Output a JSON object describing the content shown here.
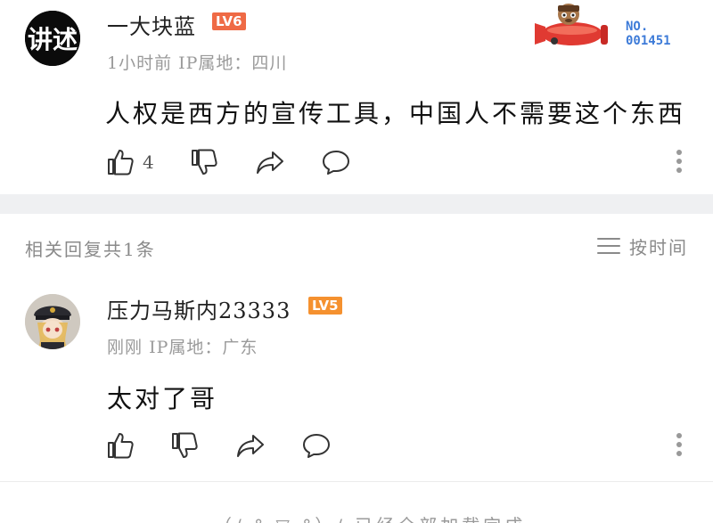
{
  "main_comment": {
    "avatar_text": "讲述",
    "username": "一大块蓝",
    "level": "LV6",
    "time": "1小时前",
    "ip": "IP属地：四川",
    "content": "人权是西方的宣传工具，中国人不需要这个东西",
    "like_count": "4",
    "badge": {
      "label": "NO.",
      "number": "001451"
    }
  },
  "replies_header": {
    "count_text": "相关回复共1条",
    "sort_label": "按时间"
  },
  "reply_comment": {
    "username": "压力马斯内23333",
    "level": "LV5",
    "time": "刚刚",
    "ip": "IP属地：广东",
    "content": "太对了哥"
  },
  "footer": {
    "note": "（/ ° ▽ °）/ 已经全部加载完成"
  },
  "colors": {
    "lv6": "#ef6a45",
    "lv5": "#f5912f",
    "divider": "#eff0f2",
    "badge_blue": "#3d7bd8"
  },
  "icons": [
    "like-icon",
    "dislike-icon",
    "share-icon",
    "comment-icon",
    "more-icon",
    "sort-icon",
    "plane-badge-icon"
  ]
}
